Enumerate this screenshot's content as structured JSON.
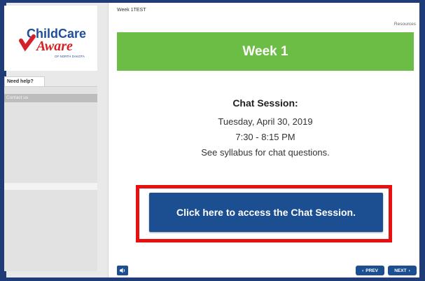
{
  "sidebar": {
    "logo": {
      "line1": "ChildCare",
      "line2": "Aware",
      "line3": "OF NORTH DAKOTA",
      "colors": {
        "blue": "#1f4e9c",
        "red": "#d62027"
      }
    },
    "help_tab": "Need help?",
    "contact_item": "Contact us"
  },
  "header": {
    "lesson_title": "Week 1TEST",
    "resources": "Resources"
  },
  "banner": {
    "title": "Week 1",
    "color": "#6cbd45"
  },
  "session": {
    "title": "Chat Session:",
    "date": "Tuesday, April 30, 2019",
    "time": "7:30 - 8:15 PM",
    "note": "See syllabus for chat questions."
  },
  "access_button": {
    "label": "Click here to access the Chat Session.",
    "color": "#1c4f92",
    "highlight_color": "#e80f0f"
  },
  "player_controls": {
    "sound_icon": "speaker-icon",
    "prev_label": "PREV",
    "next_label": "NEXT"
  }
}
